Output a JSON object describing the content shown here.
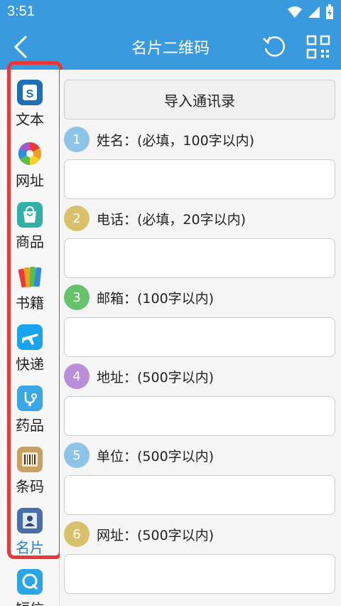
{
  "status_bar": {
    "time": "3:51"
  },
  "header": {
    "title": "名片二维码"
  },
  "sidebar": {
    "items": [
      {
        "label": "文本",
        "icon": "text-icon",
        "color": "#1f6fb5"
      },
      {
        "label": "网址",
        "icon": "url-icon",
        "color": "#f0a020"
      },
      {
        "label": "商品",
        "icon": "product-icon",
        "color": "#31b0a8"
      },
      {
        "label": "书籍",
        "icon": "book-icon",
        "color": "#e44b2c"
      },
      {
        "label": "快递",
        "icon": "delivery-icon",
        "color": "#19a4f0"
      },
      {
        "label": "药品",
        "icon": "medicine-icon",
        "color": "#3aa8e6"
      },
      {
        "label": "条码",
        "icon": "barcode-icon",
        "color": "#c9a063"
      },
      {
        "label": "名片",
        "icon": "card-icon",
        "color": "#4a6fa8",
        "active": true
      },
      {
        "label": "短信",
        "icon": "sms-icon",
        "color": "#2aa5e8"
      }
    ]
  },
  "main": {
    "import_button": "导入通讯录",
    "fields": [
      {
        "num": "1",
        "label": "姓名：(必填，100字以内)",
        "color": "#8cc4e8",
        "value": ""
      },
      {
        "num": "2",
        "label": "电话：(必填，20字以内)",
        "color": "#d8c16a",
        "value": ""
      },
      {
        "num": "3",
        "label": "邮箱：(100字以内)",
        "color": "#67c36b",
        "value": ""
      },
      {
        "num": "4",
        "label": "地址：(500字以内)",
        "color": "#b88fd8",
        "value": ""
      },
      {
        "num": "5",
        "label": "单位：(500字以内)",
        "color": "#8cc4e8",
        "value": ""
      },
      {
        "num": "6",
        "label": "网址：(500字以内)",
        "color": "#d8c16a",
        "value": ""
      }
    ]
  },
  "colors": {
    "primary": "#3a9ae0",
    "highlight": "#e8393a",
    "active_text": "#2a7ed0"
  }
}
